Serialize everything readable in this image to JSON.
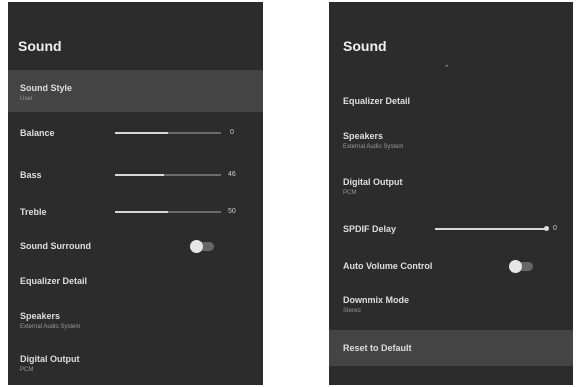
{
  "left": {
    "title": "Sound",
    "sound_style": {
      "label": "Sound Style",
      "value": "User"
    },
    "balance": {
      "label": "Balance",
      "value": "0",
      "level": 0.5
    },
    "bass": {
      "label": "Bass",
      "value": "46",
      "level": 0.46
    },
    "treble": {
      "label": "Treble",
      "value": "50",
      "level": 0.5
    },
    "sound_surround": {
      "label": "Sound Surround",
      "on": false
    },
    "equalizer": {
      "label": "Equalizer Detail"
    },
    "speakers": {
      "label": "Speakers",
      "value": "External Audio System"
    },
    "digital_output": {
      "label": "Digital Output",
      "value": "PCM"
    }
  },
  "right": {
    "title": "Sound",
    "scroll_up_icon": "chevron-up-icon",
    "equalizer": {
      "label": "Equalizer Detail"
    },
    "speakers": {
      "label": "Speakers",
      "value": "External Audio System"
    },
    "digital_output": {
      "label": "Digital Output",
      "value": "PCM"
    },
    "spdif_delay": {
      "label": "SPDIF Delay",
      "value": "0",
      "level": 1.0
    },
    "auto_volume": {
      "label": "Auto Volume Control",
      "on": false
    },
    "downmix": {
      "label": "Downmix Mode",
      "value": "Stereo"
    },
    "reset": {
      "label": "Reset to Default"
    }
  },
  "colors": {
    "panel_bg": "#2c2c2c",
    "selected_bg": "#444444",
    "text": "#e8e8e8"
  }
}
